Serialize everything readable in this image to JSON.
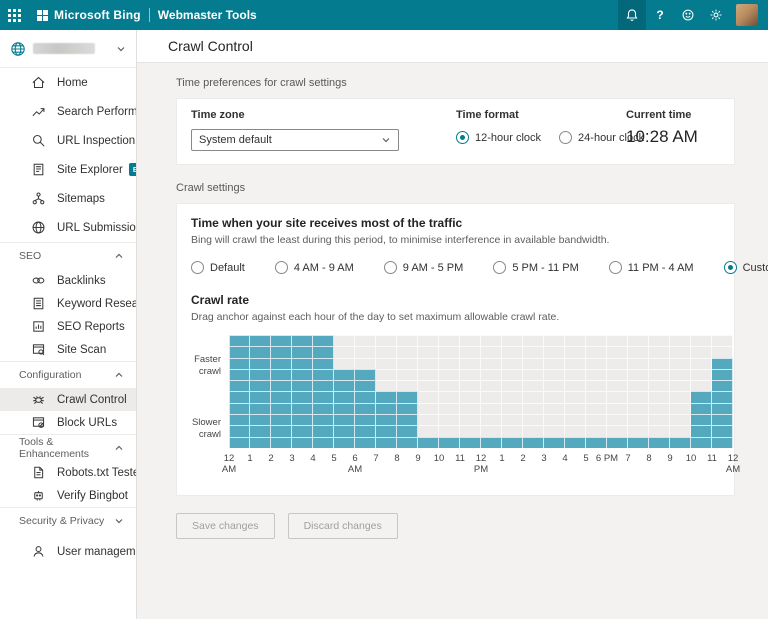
{
  "colors": {
    "topbar": "#047B8E",
    "accent": "#047B8E",
    "chart_fill": "#55A9BF",
    "chart_empty": "#EDECEA",
    "selected_item_bg": "#EDEBE9"
  },
  "topbar": {
    "product": "Microsoft Bing",
    "suite": "Webmaster Tools",
    "help_glyph": "?"
  },
  "header": {
    "title": "Crawl Control"
  },
  "sidebar": {
    "site_selector": {
      "name_redacted": true
    },
    "sections": [
      {
        "header": null,
        "items": [
          {
            "label": "Home",
            "icon": "home-icon"
          },
          {
            "label": "Search Performance",
            "icon": "trend-icon"
          },
          {
            "label": "URL Inspection",
            "icon": "inspect-icon"
          },
          {
            "label": "Site Explorer",
            "icon": "explorer-icon",
            "badge": "BETA"
          },
          {
            "label": "Sitemaps",
            "icon": "sitemap-icon"
          },
          {
            "label": "URL Submission",
            "icon": "globe-icon"
          }
        ]
      },
      {
        "header": "SEO",
        "collapsed": false,
        "items": [
          {
            "label": "Backlinks",
            "icon": "backlinks-icon"
          },
          {
            "label": "Keyword Research",
            "icon": "keyword-icon"
          },
          {
            "label": "SEO Reports",
            "icon": "report-icon"
          },
          {
            "label": "Site Scan",
            "icon": "scan-icon"
          }
        ]
      },
      {
        "header": "Configuration",
        "collapsed": false,
        "items": [
          {
            "label": "Crawl Control",
            "icon": "crawl-icon",
            "selected": true
          },
          {
            "label": "Block URLs",
            "icon": "block-icon"
          }
        ]
      },
      {
        "header": "Tools & Enhancements",
        "collapsed": false,
        "items": [
          {
            "label": "Robots.txt Tester",
            "icon": "robots-icon"
          },
          {
            "label": "Verify Bingbot",
            "icon": "bingbot-icon"
          }
        ]
      },
      {
        "header": "Security & Privacy",
        "collapsed": true,
        "items": [
          {
            "label": "User management",
            "icon": "user-icon"
          }
        ]
      }
    ]
  },
  "time_preferences": {
    "section_label": "Time preferences for crawl settings",
    "time_zone_label": "Time zone",
    "time_zone_value": "System default",
    "time_format_label": "Time format",
    "formats": [
      "12-hour clock",
      "24-hour clock"
    ],
    "selected_format": "12-hour clock",
    "current_time_label": "Current time",
    "current_time_value": "10:28 AM"
  },
  "crawl_settings": {
    "section_label": "Crawl settings",
    "traffic_title": "Time when your site receives most of the traffic",
    "traffic_subtitle": "Bing will crawl the least during this period, to minimise interference in available bandwidth.",
    "options": [
      "Default",
      "4 AM - 9 AM",
      "9 AM - 5 PM",
      "5 PM - 11 PM",
      "11 PM - 4 AM",
      "Custom"
    ],
    "selected_option": "Custom",
    "crawl_rate_title": "Crawl rate",
    "crawl_rate_subtitle": "Drag anchor against each hour of the day to set maximum allowable crawl rate.",
    "y_axis_top_label": "Faster crawl",
    "y_axis_bottom_label": "Slower crawl"
  },
  "chart_data": {
    "type": "bar",
    "title": "Crawl rate",
    "ylabel_top": "Faster crawl",
    "ylabel_bottom": "Slower crawl",
    "ylim": [
      0,
      10
    ],
    "grid": true,
    "hours": [
      "12 AM",
      "1 AM",
      "2 AM",
      "3 AM",
      "4 AM",
      "5 AM",
      "6 AM",
      "7 AM",
      "8 AM",
      "9 AM",
      "10 AM",
      "11 AM",
      "12 PM",
      "1 PM",
      "2 PM",
      "3 PM",
      "4 PM",
      "5 PM",
      "6 PM",
      "7 PM",
      "8 PM",
      "9 PM",
      "10 PM",
      "11 PM"
    ],
    "values": [
      10,
      10,
      10,
      10,
      10,
      7,
      7,
      5,
      5,
      1,
      1,
      1,
      1,
      1,
      1,
      1,
      1,
      1,
      1,
      1,
      1,
      1,
      5,
      8
    ],
    "x_boundary_labels": [
      [
        "12",
        "AM"
      ],
      [
        "1"
      ],
      [
        "2"
      ],
      [
        "3"
      ],
      [
        "4"
      ],
      [
        "5"
      ],
      [
        "6",
        "AM"
      ],
      [
        "7"
      ],
      [
        "8"
      ],
      [
        "9"
      ],
      [
        "10"
      ],
      [
        "11"
      ],
      [
        "12",
        "PM"
      ],
      [
        "1"
      ],
      [
        "2"
      ],
      [
        "3"
      ],
      [
        "4"
      ],
      [
        "5"
      ],
      [
        "6 PM"
      ],
      [
        "7"
      ],
      [
        "8"
      ],
      [
        "9"
      ],
      [
        "10"
      ],
      [
        "11"
      ],
      [
        "12",
        "AM"
      ]
    ]
  },
  "buttons": {
    "save": "Save changes",
    "discard": "Discard changes"
  }
}
